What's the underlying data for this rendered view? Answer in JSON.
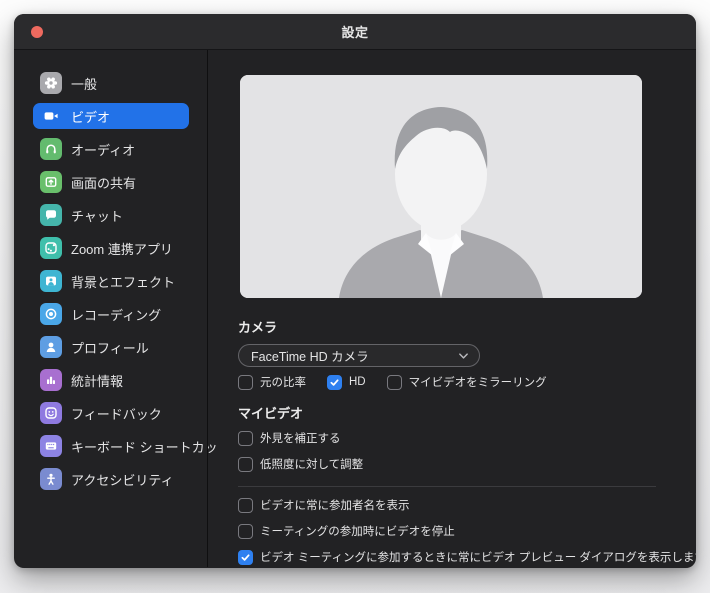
{
  "window": {
    "title": "設定"
  },
  "sidebar": {
    "items": [
      {
        "key": "general",
        "label": "一般",
        "icon": "gear-icon",
        "tile_color": "#a9a9ad",
        "selected": false
      },
      {
        "key": "video",
        "label": "ビデオ",
        "icon": "video-camera-icon",
        "tile_color": "",
        "selected": true
      },
      {
        "key": "audio",
        "label": "オーディオ",
        "icon": "headphones-icon",
        "tile_color": "#63bb6e",
        "selected": false
      },
      {
        "key": "screen-share",
        "label": "画面の共有",
        "icon": "screen-share-icon",
        "tile_color": "#69bf6b",
        "selected": false
      },
      {
        "key": "chat",
        "label": "チャット",
        "icon": "chat-bubble-icon",
        "tile_color": "#45b5ab",
        "selected": false
      },
      {
        "key": "zoom-apps",
        "label": "Zoom 連携アプリ",
        "icon": "zoom-apps-icon",
        "tile_color": "#3fbfab",
        "selected": false
      },
      {
        "key": "background-effects",
        "label": "背景とエフェクト",
        "icon": "background-effects-icon",
        "tile_color": "#3eb5d2",
        "selected": false
      },
      {
        "key": "recording",
        "label": "レコーディング",
        "icon": "record-icon",
        "tile_color": "#4aa7e8",
        "selected": false
      },
      {
        "key": "profile",
        "label": "プロフィール",
        "icon": "profile-icon",
        "tile_color": "#5e9ee3",
        "selected": false
      },
      {
        "key": "statistics",
        "label": "統計情報",
        "icon": "bar-chart-icon",
        "tile_color": "#a86fd0",
        "selected": false
      },
      {
        "key": "feedback",
        "label": "フィードバック",
        "icon": "smiley-icon",
        "tile_color": "#8f7ae0",
        "selected": false
      },
      {
        "key": "keyboard-shortcuts",
        "label": "キーボード ショートカッ",
        "icon": "keyboard-icon",
        "tile_color": "#8d83e3",
        "selected": false
      },
      {
        "key": "accessibility",
        "label": "アクセシビリティ",
        "icon": "accessibility-icon",
        "tile_color": "#7a8bd0",
        "selected": false
      }
    ]
  },
  "main": {
    "camera_label": "カメラ",
    "camera_select": {
      "value": "FaceTime HD カメラ"
    },
    "top_checkboxes": [
      {
        "key": "original-ratio",
        "label": "元の比率",
        "checked": false
      },
      {
        "key": "hd",
        "label": "HD",
        "checked": true
      },
      {
        "key": "mirror-my-video",
        "label": "マイビデオをミラーリング",
        "checked": false
      }
    ],
    "my_video_label": "マイビデオ",
    "my_video_checkboxes": [
      {
        "key": "touch-up-appearance",
        "label": "外見を補正する",
        "checked": false
      },
      {
        "key": "adjust-low-light",
        "label": "低照度に対して調整",
        "checked": false
      }
    ],
    "bottom_checkboxes": [
      {
        "key": "always-display-participant-names",
        "label": "ビデオに常に参加者名を表示",
        "checked": false
      },
      {
        "key": "stop-video-when-joining",
        "label": "ミーティングの参加時にビデオを停止",
        "checked": false
      },
      {
        "key": "always-show-video-preview-dialog",
        "label": "ビデオ ミーティングに参加するときに常にビデオ プレビュー ダイアログを表示します",
        "checked": true
      }
    ]
  },
  "colors": {
    "selected_item_blue": "#2272e8",
    "checkbox_blue": "#2e80f0",
    "close_button_red": "#ee6a5f"
  }
}
